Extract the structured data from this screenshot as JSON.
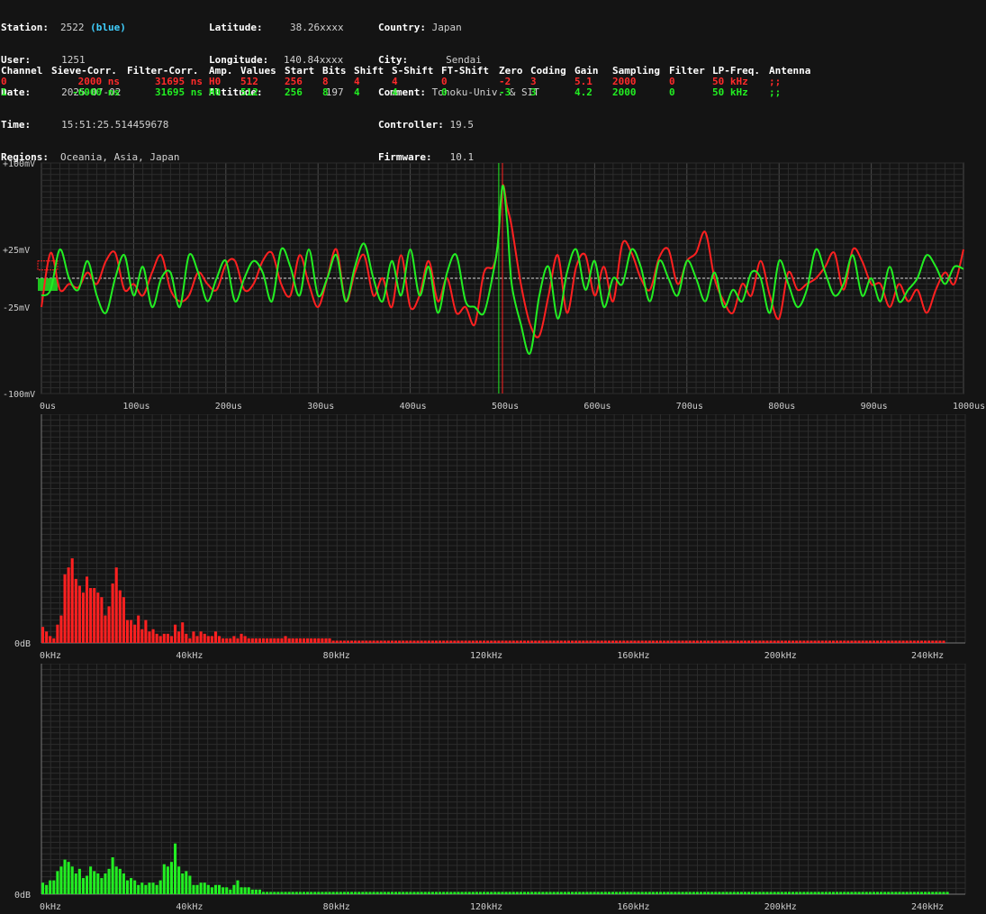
{
  "header": {
    "col1": [
      {
        "label": "Station:",
        "value": "2522",
        "extra": "(blue)"
      },
      {
        "label": "User:",
        "value": "1251"
      },
      {
        "label": "Date:",
        "value": "2025-07-02"
      },
      {
        "label": "Time:",
        "value": "15:51:25.514459678"
      },
      {
        "label": "Regions:",
        "value": "Oceania, Asia, Japan"
      }
    ],
    "col2": [
      {
        "label": "Latitude:",
        "value": "38.26xxxx"
      },
      {
        "label": "Longitude:",
        "value": "140.84xxxx"
      },
      {
        "label": "Altitude:",
        "value": "197"
      }
    ],
    "col3": [
      {
        "label": "Country:",
        "value": "Japan"
      },
      {
        "label": "City:",
        "value": "Sendai"
      },
      {
        "label": "Comment:",
        "value": "Tohoku-Univ. & SIT"
      },
      {
        "label": "Controller:",
        "value": "19.5"
      },
      {
        "label": "Firmware:",
        "value": "10.1"
      }
    ]
  },
  "table": {
    "headers": [
      "Channel",
      "Sieve-Corr.",
      "Filter-Corr.",
      "Amp.",
      "Values",
      "Start",
      "Bits",
      "Shift",
      "S-Shift",
      "FT-Shift",
      "Zero",
      "Coding",
      "Gain",
      "Sampling",
      "Filter",
      "LP-Freq.",
      "Antenna"
    ],
    "rows": [
      [
        "0",
        "2000 ns",
        "31695 ns",
        "H0",
        "512",
        "256",
        "8",
        "4",
        "4",
        "0",
        "-2",
        "3",
        "5.1",
        "2000",
        "0",
        "50 kHz",
        ";;"
      ],
      [
        "1",
        "-6000 ns",
        "31695 ns",
        "H0",
        "512",
        "256",
        "8",
        "4",
        "4",
        "0",
        "-3",
        "3",
        "4.2",
        "2000",
        "0",
        "50 kHz",
        ";;"
      ]
    ]
  },
  "colors": {
    "ch0": "#ff2020",
    "ch1": "#22ee22",
    "grid": "#3a3a3a",
    "axis": "#cccccc"
  },
  "chart_data": [
    {
      "type": "line",
      "title": "",
      "ylim": [
        -100,
        100
      ],
      "xlim": [
        0,
        1000
      ],
      "yticks": [
        {
          "v": 100,
          "label": "+100mV"
        },
        {
          "v": 25,
          "label": "+25mV"
        },
        {
          "v": -25,
          "label": "-25mV"
        },
        {
          "v": -100,
          "label": "-100mV"
        }
      ],
      "xticks": [
        "0us",
        "100us",
        "200us",
        "300us",
        "400us",
        "500us",
        "600us",
        "700us",
        "800us",
        "900us",
        "1000us"
      ],
      "markers": [
        {
          "x": 500,
          "color": "ch0"
        },
        {
          "x": 496,
          "color": "ch1"
        }
      ],
      "series": [
        {
          "color": "ch0",
          "x": [
            0,
            10,
            20,
            30,
            40,
            50,
            60,
            70,
            80,
            90,
            100,
            110,
            120,
            130,
            140,
            150,
            160,
            170,
            180,
            190,
            200,
            210,
            220,
            230,
            240,
            250,
            260,
            270,
            280,
            290,
            300,
            310,
            320,
            330,
            340,
            350,
            360,
            370,
            380,
            390,
            400,
            410,
            420,
            430,
            440,
            450,
            460,
            470,
            480,
            490,
            495,
            500,
            505,
            510,
            520,
            530,
            540,
            550,
            560,
            570,
            580,
            590,
            600,
            610,
            620,
            630,
            640,
            650,
            660,
            670,
            680,
            690,
            700,
            710,
            720,
            730,
            740,
            750,
            760,
            770,
            780,
            790,
            800,
            810,
            820,
            830,
            840,
            850,
            860,
            870,
            880,
            890,
            900,
            910,
            920,
            930,
            940,
            950,
            960,
            970,
            980,
            990,
            1000
          ],
          "y": [
            -25,
            22,
            -10,
            -5,
            -8,
            5,
            -5,
            15,
            22,
            -10,
            -5,
            -15,
            5,
            20,
            -10,
            -20,
            -15,
            5,
            -5,
            -10,
            12,
            15,
            -10,
            -5,
            15,
            22,
            -5,
            -15,
            20,
            -5,
            -25,
            0,
            25,
            -20,
            5,
            20,
            -15,
            0,
            -25,
            20,
            -25,
            -15,
            15,
            -20,
            0,
            -30,
            -25,
            -40,
            5,
            10,
            30,
            80,
            62,
            45,
            -5,
            -40,
            -50,
            -15,
            20,
            -30,
            10,
            20,
            -15,
            10,
            -20,
            30,
            22,
            0,
            -10,
            18,
            25,
            -5,
            15,
            22,
            40,
            0,
            -20,
            -30,
            -5,
            -15,
            15,
            -15,
            -35,
            5,
            -10,
            -5,
            0,
            10,
            22,
            -10,
            25,
            15,
            -5,
            -5,
            -25,
            -5,
            -20,
            -10,
            -30,
            -10,
            5,
            -5,
            25
          ]
        },
        {
          "color": "ch1",
          "x": [
            0,
            10,
            20,
            30,
            40,
            50,
            60,
            70,
            80,
            90,
            100,
            110,
            120,
            130,
            140,
            150,
            160,
            170,
            180,
            190,
            200,
            210,
            220,
            230,
            240,
            250,
            260,
            270,
            280,
            290,
            300,
            310,
            320,
            330,
            340,
            350,
            360,
            370,
            380,
            390,
            400,
            410,
            420,
            430,
            440,
            450,
            460,
            470,
            480,
            490,
            495,
            500,
            505,
            510,
            520,
            530,
            540,
            550,
            560,
            570,
            580,
            590,
            600,
            610,
            620,
            630,
            640,
            650,
            660,
            670,
            680,
            690,
            700,
            710,
            720,
            730,
            740,
            750,
            760,
            770,
            780,
            790,
            800,
            810,
            820,
            830,
            840,
            850,
            860,
            870,
            880,
            890,
            900,
            910,
            920,
            930,
            940,
            950,
            960,
            970,
            980,
            990,
            1000
          ],
          "y": [
            -15,
            -10,
            25,
            0,
            -10,
            15,
            -15,
            -30,
            0,
            20,
            -15,
            10,
            -25,
            0,
            5,
            -25,
            20,
            5,
            -20,
            0,
            15,
            -20,
            0,
            15,
            5,
            -20,
            25,
            10,
            -15,
            25,
            -15,
            0,
            20,
            -20,
            10,
            30,
            0,
            -20,
            15,
            -15,
            25,
            -15,
            10,
            -30,
            5,
            20,
            -20,
            -25,
            -30,
            5,
            30,
            80,
            50,
            -5,
            -40,
            -65,
            -15,
            10,
            -35,
            5,
            25,
            -10,
            15,
            -25,
            0,
            -5,
            25,
            10,
            -20,
            15,
            0,
            -15,
            15,
            0,
            -20,
            5,
            -25,
            -10,
            -20,
            5,
            0,
            -30,
            15,
            -5,
            -25,
            -10,
            25,
            5,
            -15,
            -5,
            20,
            -15,
            0,
            -20,
            10,
            -20,
            -10,
            0,
            20,
            10,
            -5,
            10,
            8
          ]
        }
      ]
    },
    {
      "type": "bar",
      "ylabel": "0dB",
      "xlim": [
        0,
        250
      ],
      "xticks": [
        "0kHz",
        "40kHz",
        "80kHz",
        "120kHz",
        "160kHz",
        "200kHz",
        "240kHz"
      ],
      "color": "ch0",
      "bin_width_khz": 1.0,
      "values": [
        0.07,
        0.05,
        0.03,
        0.02,
        0.08,
        0.12,
        0.3,
        0.33,
        0.37,
        0.28,
        0.25,
        0.22,
        0.29,
        0.24,
        0.24,
        0.22,
        0.2,
        0.12,
        0.16,
        0.26,
        0.33,
        0.23,
        0.2,
        0.1,
        0.1,
        0.08,
        0.12,
        0.06,
        0.1,
        0.05,
        0.06,
        0.04,
        0.03,
        0.04,
        0.04,
        0.03,
        0.08,
        0.05,
        0.09,
        0.04,
        0.02,
        0.05,
        0.03,
        0.05,
        0.04,
        0.03,
        0.03,
        0.05,
        0.03,
        0.02,
        0.02,
        0.02,
        0.03,
        0.02,
        0.04,
        0.03,
        0.02,
        0.02,
        0.02,
        0.02,
        0.02,
        0.02,
        0.02,
        0.02,
        0.02,
        0.02,
        0.03,
        0.02,
        0.02,
        0.02,
        0.02,
        0.02,
        0.02,
        0.02,
        0.02,
        0.02,
        0.02,
        0.02,
        0.02,
        0.01,
        0.01,
        0.01,
        0.01,
        0.01,
        0.01,
        0.01,
        0.01,
        0.01,
        0.01,
        0.01,
        0.01,
        0.01,
        0.01,
        0.01,
        0.01,
        0.01,
        0.01,
        0.01,
        0.01,
        0.01,
        0.01,
        0.01,
        0.01,
        0.01,
        0.01,
        0.01,
        0.01,
        0.01,
        0.01,
        0.01,
        0.01,
        0.01,
        0.01,
        0.01,
        0.01,
        0.01,
        0.01,
        0.01,
        0.01,
        0.01,
        0.01,
        0.01,
        0.01,
        0.01,
        0.01,
        0.01,
        0.01,
        0.01,
        0.01,
        0.01,
        0.01,
        0.01,
        0.01,
        0.01,
        0.01,
        0.01,
        0.01,
        0.01,
        0.01,
        0.01,
        0.01,
        0.01,
        0.01,
        0.01,
        0.01,
        0.01,
        0.01,
        0.01,
        0.01,
        0.01,
        0.01,
        0.01,
        0.01,
        0.01,
        0.01,
        0.01,
        0.01,
        0.01,
        0.01,
        0.01,
        0.01,
        0.01,
        0.01,
        0.01,
        0.01,
        0.01,
        0.01,
        0.01,
        0.01,
        0.01,
        0.01,
        0.01,
        0.01,
        0.01,
        0.01,
        0.01,
        0.01,
        0.01,
        0.01,
        0.01,
        0.01,
        0.01,
        0.01,
        0.01,
        0.01,
        0.01,
        0.01,
        0.01,
        0.01,
        0.01,
        0.01,
        0.01,
        0.01,
        0.01,
        0.01,
        0.01,
        0.01,
        0.01,
        0.01,
        0.01,
        0.01,
        0.01,
        0.01,
        0.01,
        0.01,
        0.01,
        0.01,
        0.01,
        0.01,
        0.01,
        0.01,
        0.01,
        0.01,
        0.01,
        0.01,
        0.01,
        0.01,
        0.01,
        0.01,
        0.01,
        0.01,
        0.01,
        0.01,
        0.01,
        0.01,
        0.01,
        0.01,
        0.01,
        0.01,
        0.01,
        0.01,
        0.01,
        0.01,
        0.01,
        0.01,
        0.01,
        0.01,
        0.01,
        0.01,
        0.01,
        0.01,
        0.01,
        0.01,
        0.01,
        0.01,
        0.01
      ]
    },
    {
      "type": "bar",
      "ylabel": "0dB",
      "xlim": [
        0,
        250
      ],
      "xticks": [
        "0kHz",
        "40kHz",
        "80kHz",
        "120kHz",
        "160kHz",
        "200kHz",
        "240kHz"
      ],
      "color": "ch1",
      "bin_width_khz": 1.0,
      "values": [
        0.05,
        0.04,
        0.06,
        0.06,
        0.1,
        0.12,
        0.15,
        0.14,
        0.12,
        0.09,
        0.11,
        0.07,
        0.08,
        0.12,
        0.1,
        0.09,
        0.07,
        0.09,
        0.11,
        0.16,
        0.12,
        0.11,
        0.09,
        0.06,
        0.07,
        0.06,
        0.04,
        0.05,
        0.04,
        0.05,
        0.05,
        0.04,
        0.06,
        0.13,
        0.12,
        0.14,
        0.22,
        0.12,
        0.09,
        0.1,
        0.08,
        0.04,
        0.04,
        0.05,
        0.05,
        0.04,
        0.03,
        0.04,
        0.04,
        0.03,
        0.03,
        0.02,
        0.04,
        0.06,
        0.03,
        0.03,
        0.03,
        0.02,
        0.02,
        0.02,
        0.01,
        0.01,
        0.01,
        0.01,
        0.01,
        0.01,
        0.01,
        0.01,
        0.01,
        0.01,
        0.01,
        0.01,
        0.01,
        0.01,
        0.01,
        0.01,
        0.01,
        0.01,
        0.01,
        0.01,
        0.01,
        0.01,
        0.01,
        0.01,
        0.01,
        0.01,
        0.01,
        0.01,
        0.01,
        0.01,
        0.01,
        0.01,
        0.01,
        0.01,
        0.01,
        0.01,
        0.01,
        0.01,
        0.01,
        0.01,
        0.01,
        0.01,
        0.01,
        0.01,
        0.01,
        0.01,
        0.01,
        0.01,
        0.01,
        0.01,
        0.01,
        0.01,
        0.01,
        0.01,
        0.01,
        0.01,
        0.01,
        0.01,
        0.01,
        0.01,
        0.01,
        0.01,
        0.01,
        0.01,
        0.01,
        0.01,
        0.01,
        0.01,
        0.01,
        0.01,
        0.01,
        0.01,
        0.01,
        0.01,
        0.01,
        0.01,
        0.01,
        0.01,
        0.01,
        0.01,
        0.01,
        0.01,
        0.01,
        0.01,
        0.01,
        0.01,
        0.01,
        0.01,
        0.01,
        0.01,
        0.01,
        0.01,
        0.01,
        0.01,
        0.01,
        0.01,
        0.01,
        0.01,
        0.01,
        0.01,
        0.01,
        0.01,
        0.01,
        0.01,
        0.01,
        0.01,
        0.01,
        0.01,
        0.01,
        0.01,
        0.01,
        0.01,
        0.01,
        0.01,
        0.01,
        0.01,
        0.01,
        0.01,
        0.01,
        0.01,
        0.01,
        0.01,
        0.01,
        0.01,
        0.01,
        0.01,
        0.01,
        0.01,
        0.01,
        0.01,
        0.01,
        0.01,
        0.01,
        0.01,
        0.01,
        0.01,
        0.01,
        0.01,
        0.01,
        0.01,
        0.01,
        0.01,
        0.01,
        0.01,
        0.01,
        0.01,
        0.01,
        0.01,
        0.01,
        0.01,
        0.01,
        0.01,
        0.01,
        0.01,
        0.01,
        0.01,
        0.01,
        0.01,
        0.01,
        0.01,
        0.01,
        0.01,
        0.01,
        0.01,
        0.01,
        0.01,
        0.01,
        0.01,
        0.01,
        0.01,
        0.01,
        0.01,
        0.01,
        0.01,
        0.01,
        0.01,
        0.01,
        0.01,
        0.01,
        0.01,
        0.01,
        0.01,
        0.01,
        0.01,
        0.01,
        0.01,
        0.01
      ]
    }
  ]
}
